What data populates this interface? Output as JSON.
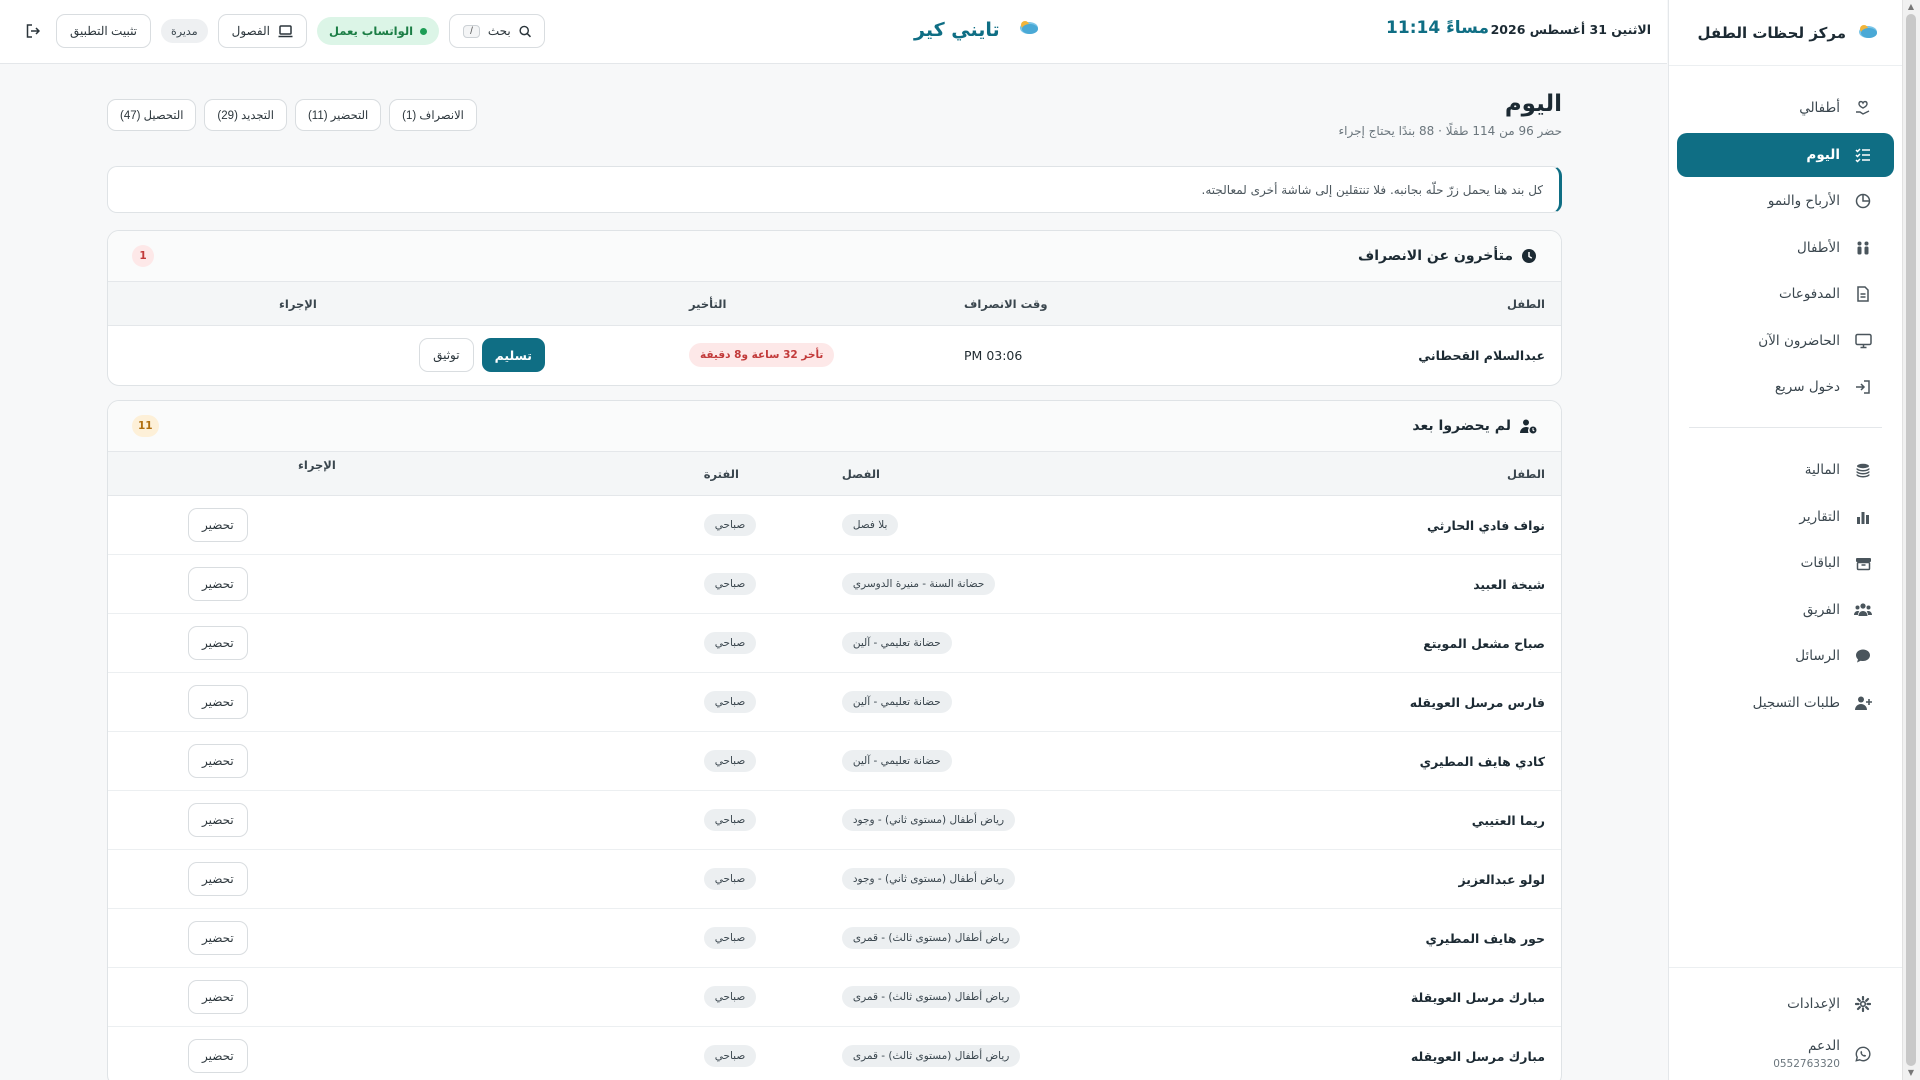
{
  "sidebar": {
    "brand": "مركز لحظات الطفل",
    "items": [
      {
        "label": "أطفالي",
        "icon": "hand-heart-icon"
      },
      {
        "label": "اليوم",
        "icon": "checklist-icon"
      },
      {
        "label": "الأرباح والنمو",
        "icon": "chart-pie-icon"
      },
      {
        "label": "الأطفال",
        "icon": "children-icon"
      },
      {
        "label": "المدفوعات",
        "icon": "receipt-icon"
      },
      {
        "label": "الحاضرون الآن",
        "icon": "monitor-icon"
      },
      {
        "label": "دخول سريع",
        "icon": "sign-in-icon"
      }
    ],
    "items2": [
      {
        "label": "المالية",
        "icon": "coins-icon"
      },
      {
        "label": "التقارير",
        "icon": "bar-chart-icon"
      },
      {
        "label": "الباقات",
        "icon": "box-icon"
      },
      {
        "label": "الفريق",
        "icon": "team-icon"
      },
      {
        "label": "الرسائل",
        "icon": "chat-icon"
      },
      {
        "label": "طلبات التسجيل",
        "icon": "user-plus-icon"
      }
    ],
    "settings": "الإعدادات",
    "support_label": "الدعم",
    "support_phone": "0552763320"
  },
  "topbar": {
    "date": "الاثنين 31 أغسطس 2026",
    "clock": "مساءً 11:14",
    "app_name": "تايني كير",
    "search": "بحث",
    "search_key": "/",
    "classes": "الفصول",
    "whatsapp": "الواتساب يعمل",
    "role": "مديرة",
    "install": "تثبيت التطبيق"
  },
  "page": {
    "title": "اليوم",
    "subtitle": "حضر 96 من 114 طفلًا · 88 بندًا يحتاج إجراء",
    "chips": [
      "التحصيل (47)",
      "التجديد (29)",
      "التحضير (11)",
      "الانصراف (1)"
    ],
    "info": "كل بند هنا يحمل زرّ حلّه بجانبه. فلا تنتقلين إلى شاشة أخرى لمعالجته."
  },
  "late": {
    "title": "متأخرون عن الانصراف",
    "count": "1",
    "headers": {
      "child": "الطفل",
      "time": "وقت الانصراف",
      "delay": "التأخير",
      "action": "الإجراء"
    },
    "row": {
      "name": "عبدالسلام القحطاني",
      "time": "03:06 PM",
      "delay": "تأخر 32 ساعة و8 دقيقة",
      "primary": "تسليم",
      "secondary": "توثيق"
    }
  },
  "absent": {
    "title": "لم يحضروا بعد",
    "count": "11",
    "headers": {
      "child": "الطفل",
      "class": "الفصل",
      "period": "الفترة",
      "action": "الإجراء"
    },
    "action_label": "تحضير",
    "rows": [
      {
        "name": "نواف فادي الحارثي",
        "class": "بلا فصل",
        "period": "صباحي"
      },
      {
        "name": "شيخة العبيد",
        "class": "حضانة السنة - منيرة الدوسري",
        "period": "صباحي"
      },
      {
        "name": "صباح مشعل المويتع",
        "class": "حضانة تعليمي - آلين",
        "period": "صباحي"
      },
      {
        "name": "فارس مرسل العويقله",
        "class": "حضانة تعليمي - آلين",
        "period": "صباحي"
      },
      {
        "name": "كادي هايف المطيري",
        "class": "حضانة تعليمي - آلين",
        "period": "صباحي"
      },
      {
        "name": "ريما العتيبي",
        "class": "رياض أطفال (مستوى ثاني) - وجود",
        "period": "صباحي"
      },
      {
        "name": "لولو عبدالعزيز",
        "class": "رياض أطفال (مستوى ثاني) - وجود",
        "period": "صباحي"
      },
      {
        "name": "حور هايف المطيري",
        "class": "رياض أطفال (مستوى ثالث) - قمرى",
        "period": "صباحي"
      },
      {
        "name": "مبارك مرسل العويقلة",
        "class": "رياض أطفال (مستوى ثالث) - قمرى",
        "period": "صباحي"
      },
      {
        "name": "مبارك مرسل العويقله",
        "class": "رياض أطفال (مستوى ثالث) - قمرى",
        "period": "صباحي"
      }
    ]
  },
  "colors": {
    "primary": "#0f6e84",
    "danger": "#c23a3a",
    "success": "#1d9d55"
  }
}
